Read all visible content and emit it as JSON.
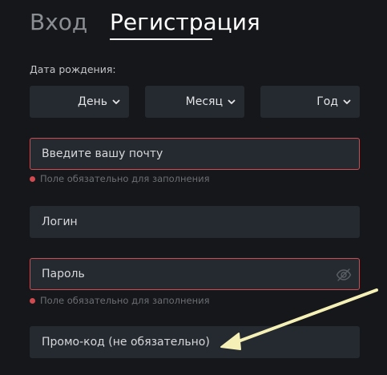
{
  "tabs": {
    "login": "Вход",
    "register": "Регистрация"
  },
  "birthdate": {
    "label": "Дата рождения:",
    "day": "День",
    "month": "Месяц",
    "year": "Год"
  },
  "fields": {
    "email": {
      "placeholder": "Введите вашу почту",
      "error": "Поле обязательно для заполнения"
    },
    "login": {
      "placeholder": "Логин"
    },
    "password": {
      "placeholder": "Пароль",
      "error": "Поле обязательно для заполнения"
    },
    "promo": {
      "placeholder": "Промо-код (не обязательно)"
    }
  },
  "colors": {
    "background": "#15171b",
    "field": "#252a31",
    "error": "#d14a4f",
    "arrow": "#f5f0b5"
  },
  "icons": {
    "chevron": "chevron-down-icon",
    "eye": "eye-off-icon",
    "arrow": "arrow-annotation"
  }
}
